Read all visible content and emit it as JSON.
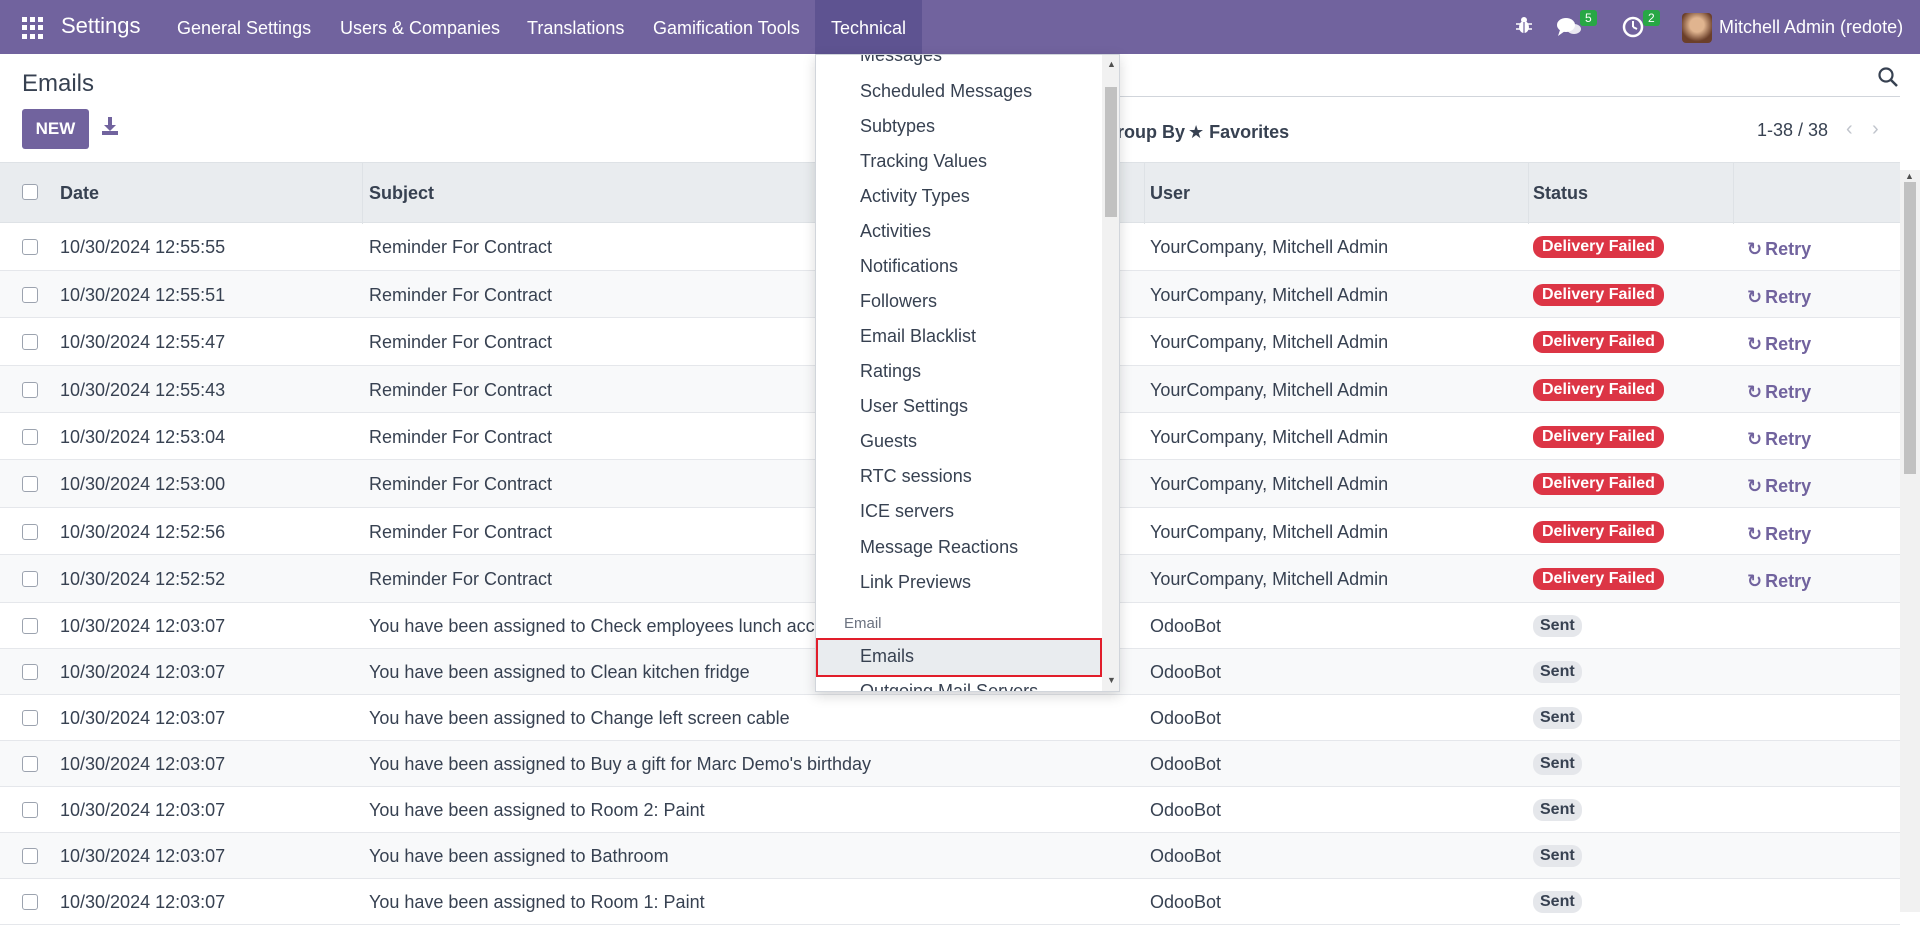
{
  "navbar": {
    "brand": "Settings",
    "menu": [
      "General Settings",
      "Users & Companies",
      "Translations",
      "Gamification Tools",
      "Technical"
    ],
    "active_menu": "Technical",
    "messages_badge": "5",
    "activities_badge": "2",
    "user": "Mitchell Admin (redote)"
  },
  "page": {
    "title": "Emails",
    "new_button": "NEW",
    "group_by": "Group By",
    "favorites": "Favorites",
    "pager": "1-38 / 38"
  },
  "table": {
    "headers": [
      "Date",
      "Subject",
      "User",
      "Status"
    ],
    "retry_label": "Retry",
    "rows": [
      {
        "date": "10/30/2024 12:55:55",
        "subject": "Reminder For Contract",
        "user": "YourCompany, Mitchell Admin",
        "status": "Delivery Failed",
        "failed": true
      },
      {
        "date": "10/30/2024 12:55:51",
        "subject": "Reminder For Contract",
        "user": "YourCompany, Mitchell Admin",
        "status": "Delivery Failed",
        "failed": true
      },
      {
        "date": "10/30/2024 12:55:47",
        "subject": "Reminder For Contract",
        "user": "YourCompany, Mitchell Admin",
        "status": "Delivery Failed",
        "failed": true
      },
      {
        "date": "10/30/2024 12:55:43",
        "subject": "Reminder For Contract",
        "user": "YourCompany, Mitchell Admin",
        "status": "Delivery Failed",
        "failed": true
      },
      {
        "date": "10/30/2024 12:53:04",
        "subject": "Reminder For Contract",
        "user": "YourCompany, Mitchell Admin",
        "status": "Delivery Failed",
        "failed": true
      },
      {
        "date": "10/30/2024 12:53:00",
        "subject": "Reminder For Contract",
        "user": "YourCompany, Mitchell Admin",
        "status": "Delivery Failed",
        "failed": true
      },
      {
        "date": "10/30/2024 12:52:56",
        "subject": "Reminder For Contract",
        "user": "YourCompany, Mitchell Admin",
        "status": "Delivery Failed",
        "failed": true
      },
      {
        "date": "10/30/2024 12:52:52",
        "subject": "Reminder For Contract",
        "user": "YourCompany, Mitchell Admin",
        "status": "Delivery Failed",
        "failed": true
      },
      {
        "date": "10/30/2024 12:03:07",
        "subject": "You have been assigned to Check employees lunch accou",
        "user": "OdooBot",
        "status": "Sent",
        "failed": false
      },
      {
        "date": "10/30/2024 12:03:07",
        "subject": "You have been assigned to Clean kitchen fridge",
        "user": "OdooBot",
        "status": "Sent",
        "failed": false
      },
      {
        "date": "10/30/2024 12:03:07",
        "subject": "You have been assigned to Change left screen cable",
        "user": "OdooBot",
        "status": "Sent",
        "failed": false
      },
      {
        "date": "10/30/2024 12:03:07",
        "subject": "You have been assigned to Buy a gift for Marc Demo's birthday",
        "user": "OdooBot",
        "status": "Sent",
        "failed": false
      },
      {
        "date": "10/30/2024 12:03:07",
        "subject": "You have been assigned to Room 2: Paint",
        "user": "OdooBot",
        "status": "Sent",
        "failed": false
      },
      {
        "date": "10/30/2024 12:03:07",
        "subject": "You have been assigned to Bathroom",
        "user": "OdooBot",
        "status": "Sent",
        "failed": false
      },
      {
        "date": "10/30/2024 12:03:07",
        "subject": "You have been assigned to Room 1: Paint",
        "user": "OdooBot",
        "status": "Sent",
        "failed": false
      }
    ]
  },
  "dropdown": {
    "items_top": [
      "Messages",
      "Scheduled Messages",
      "Subtypes",
      "Tracking Values",
      "Activity Types",
      "Activities",
      "Notifications",
      "Followers",
      "Email Blacklist",
      "Ratings",
      "User Settings",
      "Guests",
      "RTC sessions",
      "ICE servers",
      "Message Reactions",
      "Link Previews"
    ],
    "section_header": "Email",
    "active_item": "Emails",
    "next_item": "Outgoing Mail Servers"
  },
  "colors": {
    "brand": "#71639e",
    "danger": "#dc3545",
    "badge_green": "#28a745"
  }
}
